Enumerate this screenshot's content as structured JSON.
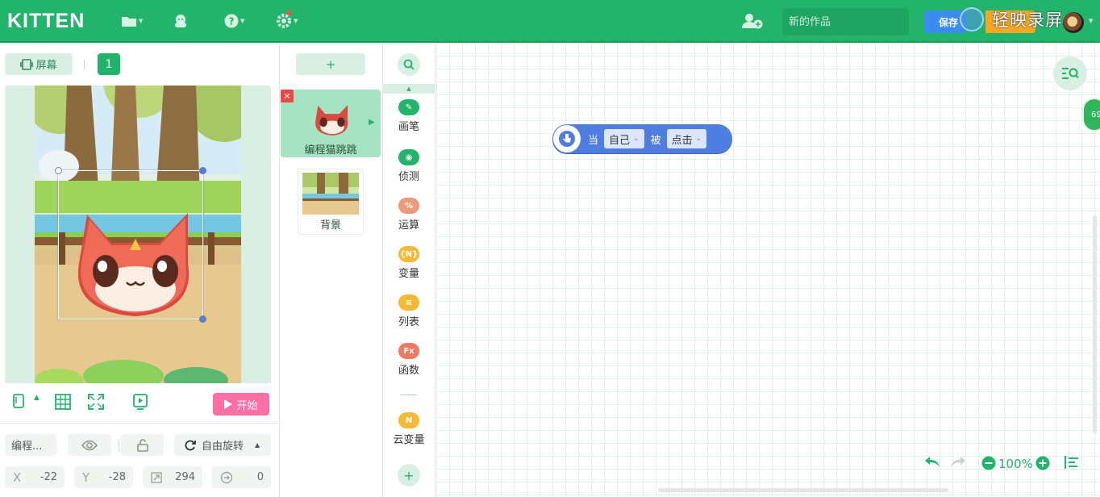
{
  "topbar": {
    "logo": "KITTEN",
    "title_placeholder": "新的作品",
    "save_label": "保存",
    "watermark": "轻映录屏",
    "icons": [
      "folder-icon",
      "sprite-icon",
      "help-icon",
      "settings-icon",
      "add-user-icon"
    ]
  },
  "left": {
    "screen_label": "屏幕",
    "page_number": "1",
    "start_label": "开始",
    "sprite_name_short": "编程...",
    "rotation_label": "自由旋转",
    "x_label": "X",
    "x_value": "-22",
    "y_label": "Y",
    "y_value": "-28",
    "size_value": "294",
    "direction_value": "0"
  },
  "sprites": {
    "add_label": "+",
    "items": [
      {
        "name": "编程猫跳跳",
        "selected": true
      },
      {
        "name": "背景",
        "selected": false
      }
    ]
  },
  "categories": [
    {
      "label": "画笔",
      "color": "#22b46b",
      "icon": "pen-icon",
      "glyph": "✎"
    },
    {
      "label": "侦测",
      "color": "#22b46b",
      "icon": "sense-icon",
      "glyph": "◉"
    },
    {
      "label": "运算",
      "color": "#ee9a79",
      "icon": "operator-icon",
      "glyph": "%"
    },
    {
      "label": "变量",
      "color": "#f5b935",
      "icon": "variable-icon",
      "glyph": "{N}"
    },
    {
      "label": "列表",
      "color": "#f5b935",
      "icon": "list-icon",
      "glyph": "≡"
    },
    {
      "label": "函数",
      "color": "#ee7a63",
      "icon": "function-icon",
      "glyph": "Fx"
    },
    {
      "label": "云变量",
      "color": "#f5b935",
      "icon": "cloud-variable-icon",
      "glyph": "N"
    }
  ],
  "block": {
    "when": "当",
    "target": "自己",
    "by": "被",
    "event": "点击"
  },
  "workspace": {
    "zoom": "100%",
    "badge": "69"
  }
}
